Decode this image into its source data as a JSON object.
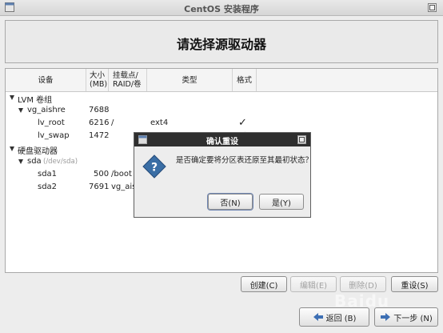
{
  "window": {
    "title": "CentOS 安装程序"
  },
  "header": {
    "heading": "请选择源驱动器"
  },
  "table": {
    "columns": {
      "device": "设备",
      "size_line1": "大小",
      "size_line2": "(MB)",
      "mount_line1": "挂载点/",
      "mount_line2": "RAID/卷",
      "type": "类型",
      "format": "格式"
    },
    "rows": [
      {
        "name": "LVM 卷组"
      },
      {
        "name": "vg_aishre",
        "size": "7688"
      },
      {
        "name": "lv_root",
        "size": "6216",
        "mount": "/",
        "type": "ext4",
        "format_checked": true
      },
      {
        "name": "lv_swap",
        "size": "1472",
        "mount": "",
        "type": "",
        "format_checked": true
      },
      {
        "name": "硬盘驱动器"
      },
      {
        "name": "sda",
        "subtext": "(/dev/sda)"
      },
      {
        "name": "sda1",
        "size": "500",
        "mount": "/boot"
      },
      {
        "name": "sda2",
        "size": "7691",
        "mount": "vg_aishre"
      }
    ]
  },
  "buttons": {
    "create": "创建(C)",
    "edit": "编辑(E)",
    "delete": "删除(D)",
    "reset": "重设(S)",
    "back": "返回 (B)",
    "next": "下一步 (N)"
  },
  "dialog": {
    "title": "确认重设",
    "message": "是否确定要将分区表还原至其最初状态？",
    "no": "否(N)",
    "yes": "是(Y)"
  },
  "watermark": {
    "text": "Baidu"
  },
  "icons": {
    "window": "window-icon",
    "dialog": "question-icon",
    "back": "arrow-left-icon",
    "next": "arrow-right-icon"
  },
  "colors": {
    "dialog_titlebar": "#2f2f2f",
    "question_icon": "#3a6ea5"
  }
}
